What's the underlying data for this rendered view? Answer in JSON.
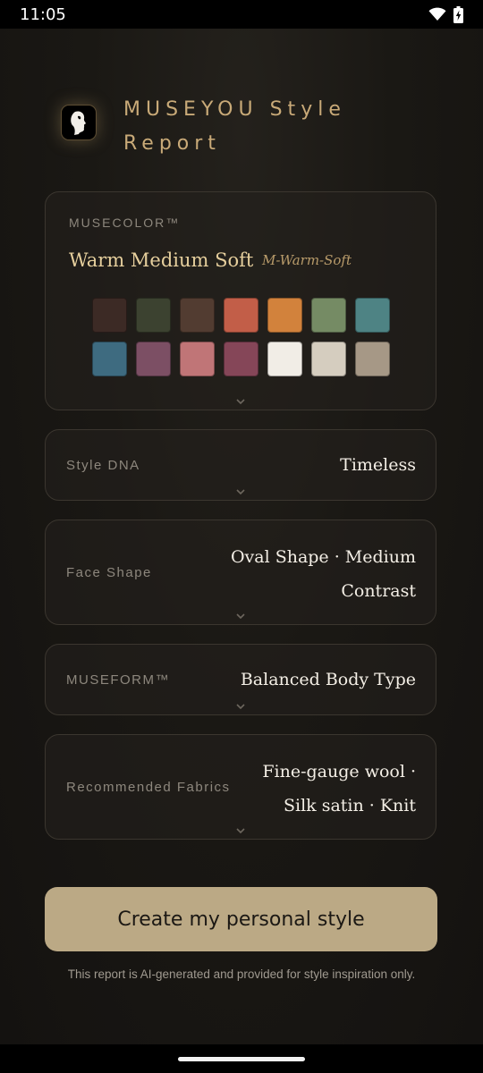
{
  "status_bar": {
    "time": "11:05",
    "icons": [
      "wifi-icon",
      "battery-charging-icon"
    ]
  },
  "header": {
    "title": "MUSEYOU Style Report",
    "logo_icon": "face-silhouette-icon"
  },
  "musecolor": {
    "label": "MUSECOLOR™",
    "season_name": "Warm Medium Soft",
    "season_code": "M-Warm-Soft",
    "palette": [
      "#3c2a25",
      "#3c4230",
      "#523c31",
      "#c25e48",
      "#d2823c",
      "#758b64",
      "#4e8384",
      "#3e6b80",
      "#7c4f64",
      "#c07577",
      "#854658",
      "#f1ede6",
      "#d5cdbf",
      "#a69886"
    ]
  },
  "rows": [
    {
      "label": "Style DNA",
      "value": "Timeless"
    },
    {
      "label": "Face Shape",
      "value": "Oval Shape · Medium Contrast"
    },
    {
      "label": "MUSEFORM™",
      "value": "Balanced Body Type"
    },
    {
      "label": "Recommended Fabrics",
      "value": "Fine-gauge wool · Silk satin · Knit"
    }
  ],
  "cta": {
    "label": "Create my personal style"
  },
  "disclaimer": "This report is AI-generated and provided for style inspiration only.",
  "theme": {
    "accent": "#c9aa78",
    "button": "#bba985",
    "background": "#141210"
  }
}
